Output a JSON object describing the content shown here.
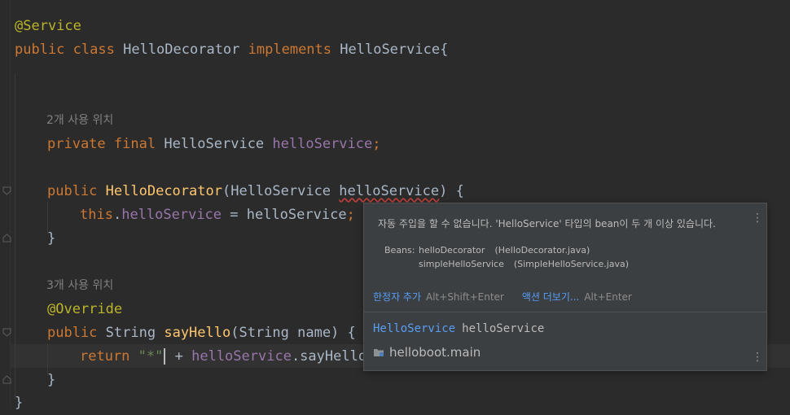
{
  "editor": {
    "line1": {
      "annotation": "@Service"
    },
    "line2": {
      "kw_public": "public",
      "kw_class": "class",
      "class_name": "HelloDecorator",
      "kw_implements": "implements",
      "iface": "HelloService",
      "brace": "{"
    },
    "inlay_field": "2개 사용 위치",
    "field_line": {
      "kw_private": "private",
      "kw_final": "final",
      "type": "HelloService",
      "name": "helloService",
      "semi": ";"
    },
    "ctor_line": {
      "kw_public": "public",
      "name": "HelloDecorator",
      "open": "(",
      "param_type": "HelloService",
      "param_name": "helloService",
      "close": ") {"
    },
    "assign_line": {
      "kw_this": "this",
      "dot": ".",
      "field": "helloService",
      "eq": " = helloService",
      "semi": ";"
    },
    "close1": "}",
    "inlay_method": "3개 사용 위치",
    "override_line": "@Override",
    "method_line": {
      "kw_public": "public",
      "ret": "String",
      "name": "sayHello",
      "params": "(String name) {"
    },
    "return_line": {
      "kw_return": "return",
      "str_open": "\"*\"",
      "plus": " + ",
      "field": "helloService",
      "call": ".sayHello("
    },
    "close2": "}",
    "close3": "}"
  },
  "popup": {
    "message": "자동 주입을 할 수 없습니다. 'HelloService' 타입의 bean이 두 개 이상 있습니다.",
    "beans_label": "Beans:",
    "beans": [
      {
        "name": "helloDecorator",
        "file": "(HelloDecorator.java)"
      },
      {
        "name": "simpleHelloService",
        "file": "(SimpleHelloService.java)"
      }
    ],
    "actions": {
      "primary_label": "한정자 추가",
      "primary_shortcut": "Alt+Shift+Enter",
      "more_label": "액션 더보기...",
      "more_shortcut": "Alt+Enter"
    },
    "declaration": {
      "type": "HelloService",
      "name": "helloService"
    },
    "module": "helloboot.main",
    "colors": {
      "link": "#589df6",
      "background": "#3c3f41"
    }
  }
}
